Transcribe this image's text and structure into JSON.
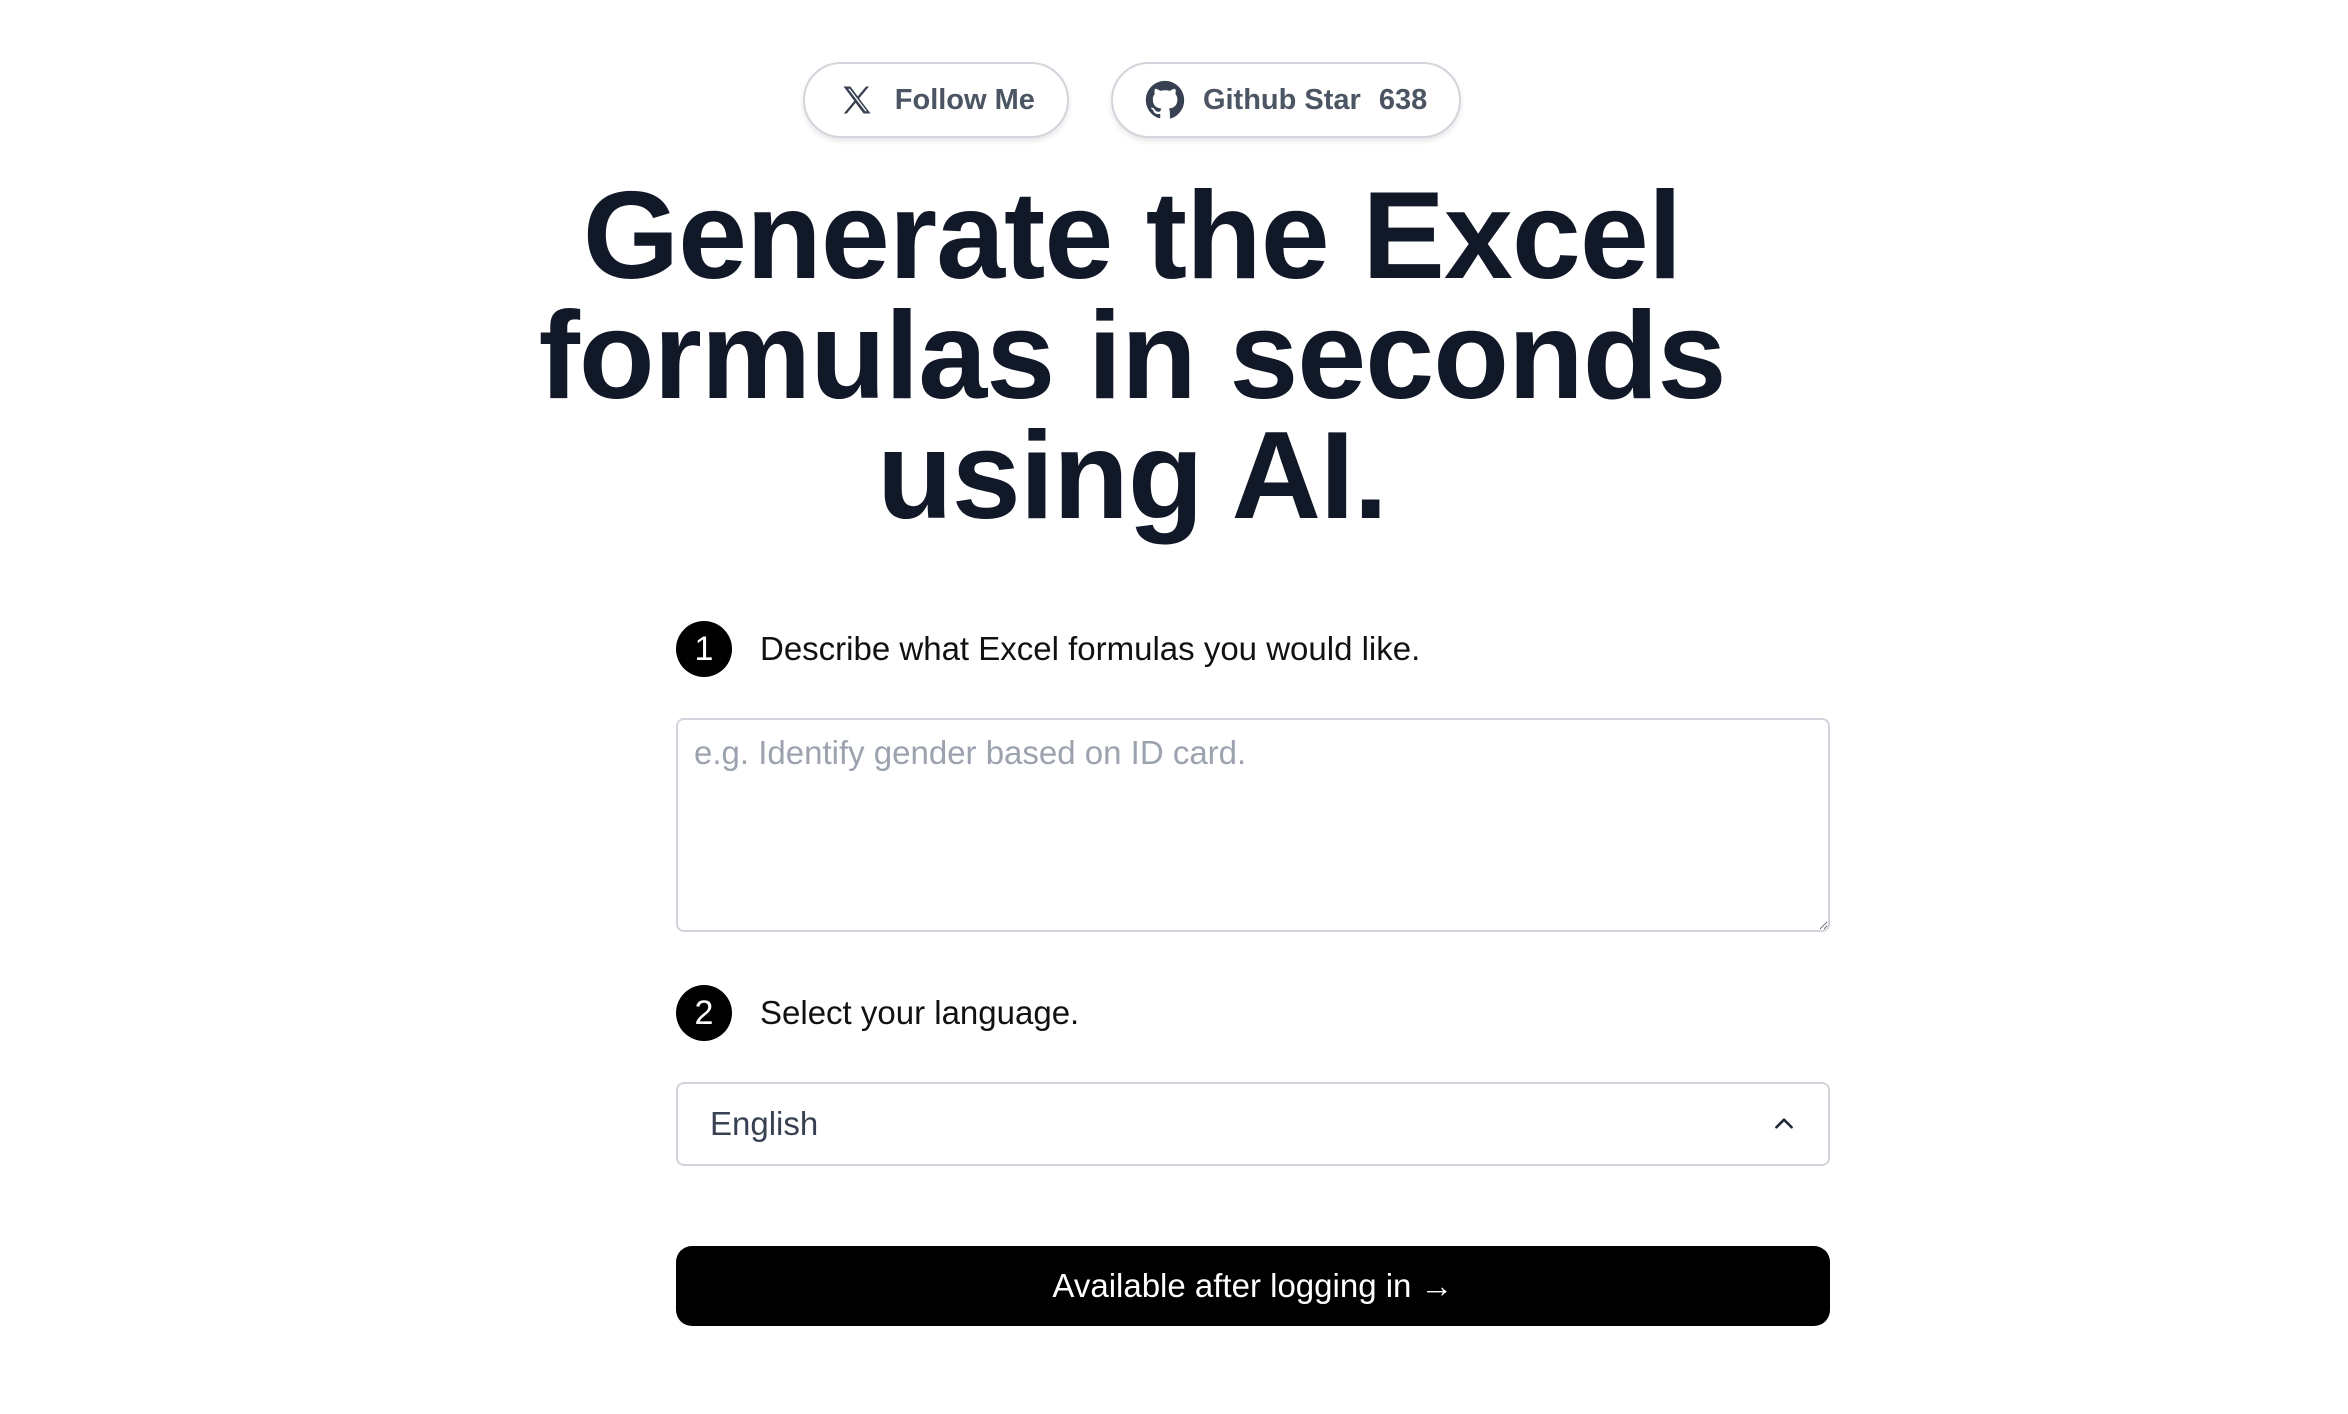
{
  "header": {
    "follow_button": {
      "label": "Follow Me",
      "icon": "x-logo-icon"
    },
    "github_button": {
      "label": "Github Star",
      "count": "638",
      "icon": "github-icon"
    }
  },
  "headline": {
    "line1": "Generate the Excel",
    "line2": "formulas in seconds",
    "line3": "using AI."
  },
  "step1": {
    "number": "1",
    "label": "Describe what Excel formulas you would like.",
    "placeholder": "e.g. Identify gender based on ID card.",
    "value": ""
  },
  "step2": {
    "number": "2",
    "label": "Select your language.",
    "selected": "English",
    "icon": "chevron-up-icon"
  },
  "submit": {
    "label": "Available after logging in →"
  },
  "colors": {
    "text_dark": "#111827",
    "button_black": "#000000",
    "border": "#d1d5db",
    "muted": "#4b5563"
  }
}
